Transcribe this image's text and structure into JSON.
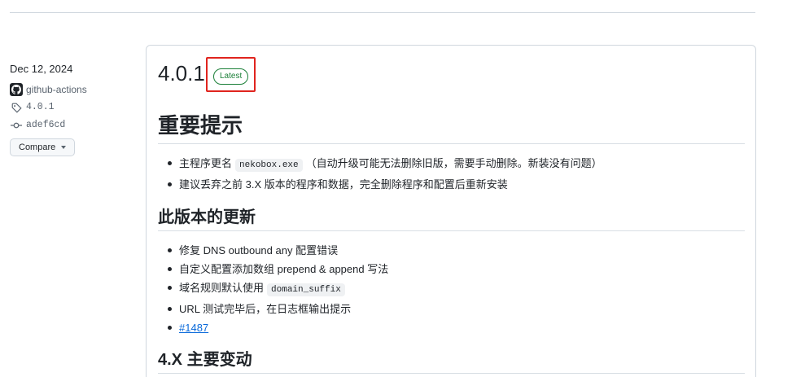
{
  "sidebar": {
    "date": "Dec 12, 2024",
    "author": "github-actions",
    "tag": "4.0.1",
    "commit": "adef6cd",
    "compare_label": "Compare"
  },
  "release": {
    "version": "4.0.1",
    "badge": "Latest",
    "highlight_color": "#e0241e",
    "badge_color": "#1a7f37"
  },
  "section_notice": {
    "title": "重要提示",
    "items": [
      {
        "before": "主程序更名",
        "code": "nekobox.exe",
        "after": "（自动升级可能无法删除旧版，需要手动删除。新装没有问题）"
      },
      {
        "text": "建议丢弃之前 3.X 版本的程序和数据，完全删除程序和配置后重新安装"
      }
    ]
  },
  "section_updates": {
    "title": "此版本的更新",
    "items": [
      {
        "text": "修复 DNS outbound any 配置错误"
      },
      {
        "text": "自定义配置添加数组 prepend & append 写法"
      },
      {
        "before": "域名规则默认使用",
        "code": "domain_suffix"
      },
      {
        "text": "URL 测试完毕后，在日志框输出提示"
      },
      {
        "link": "#1487"
      }
    ]
  },
  "section_major": {
    "title": "4.X 主要变动"
  }
}
